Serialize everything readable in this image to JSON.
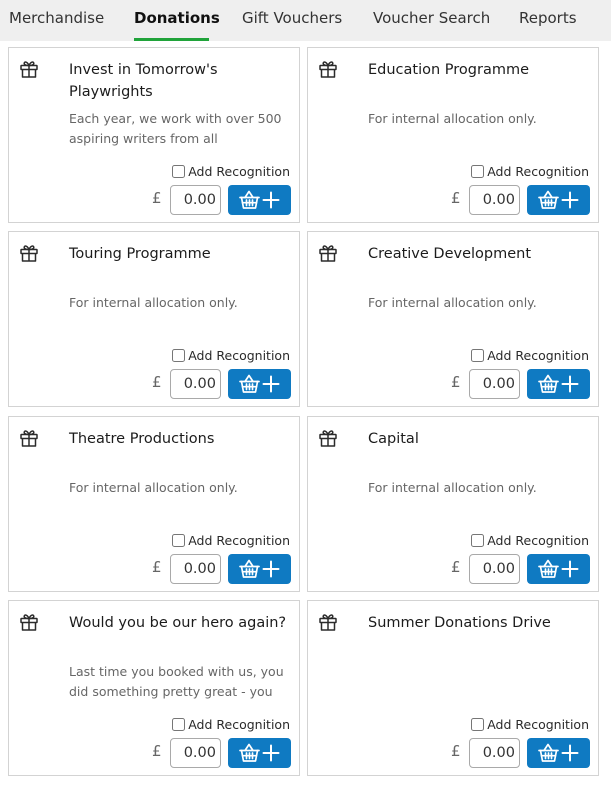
{
  "tabs": [
    {
      "label": "Merchandise",
      "active": false
    },
    {
      "label": "Donations",
      "active": true
    },
    {
      "label": "Gift Vouchers",
      "active": false
    },
    {
      "label": "Voucher Search",
      "active": false
    },
    {
      "label": "Reports",
      "active": false
    }
  ],
  "colors": {
    "accent_underline": "#20a33a",
    "add_button": "#0f7ac2"
  },
  "recognition_label": "Add Recognition",
  "currency_symbol": "£",
  "donations": [
    {
      "title": "Invest in Tomorrow's Playwrights",
      "description": "Each year, we work with over 500 aspiring writers from all",
      "amount": "0.00",
      "recognition_checked": false,
      "icon": "gift-icon",
      "button_icon": "basket-plus-icon"
    },
    {
      "title": "Education Programme",
      "description": "For internal allocation only.",
      "amount": "0.00",
      "recognition_checked": false,
      "icon": "gift-icon",
      "button_icon": "basket-plus-icon"
    },
    {
      "title": "Touring Programme",
      "description": "For internal allocation only.",
      "amount": "0.00",
      "recognition_checked": false,
      "icon": "gift-icon",
      "button_icon": "basket-plus-icon"
    },
    {
      "title": "Creative Development",
      "description": "For internal allocation only.",
      "amount": "0.00",
      "recognition_checked": false,
      "icon": "gift-icon",
      "button_icon": "basket-plus-icon"
    },
    {
      "title": "Theatre Productions",
      "description": "For internal allocation only.",
      "amount": "0.00",
      "recognition_checked": false,
      "icon": "gift-icon",
      "button_icon": "basket-plus-icon"
    },
    {
      "title": "Capital",
      "description": "For internal allocation only.",
      "amount": "0.00",
      "recognition_checked": false,
      "icon": "gift-icon",
      "button_icon": "basket-plus-icon"
    },
    {
      "title": "Would you be our hero again?",
      "description": "Last time you booked with us, you did something pretty great - you",
      "amount": "0.00",
      "recognition_checked": false,
      "icon": "gift-icon",
      "button_icon": "basket-plus-icon"
    },
    {
      "title": "Summer Donations Drive",
      "description": "",
      "amount": "0.00",
      "recognition_checked": false,
      "icon": "gift-icon",
      "button_icon": "basket-plus-icon"
    }
  ]
}
